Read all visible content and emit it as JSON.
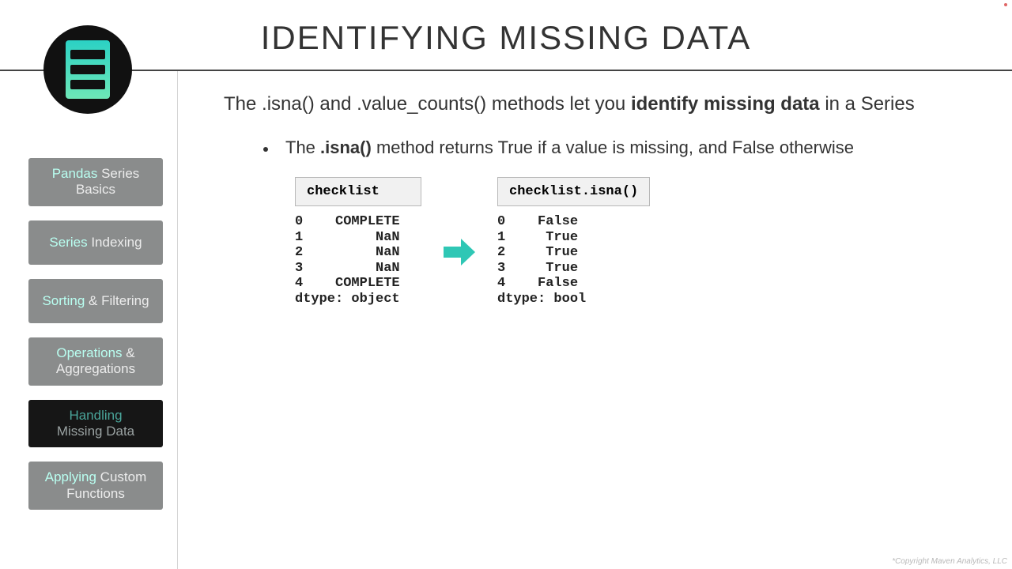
{
  "header": {
    "title": "IDENTIFYING MISSING DATA"
  },
  "sidebar": {
    "items": [
      {
        "line1_hl": "Pandas",
        "line1_rest": " Series",
        "line2": "Basics"
      },
      {
        "line1_hl": "Series",
        "line1_rest": " Indexing"
      },
      {
        "line1_hl": "Sorting",
        "line1_rest": " & Filtering"
      },
      {
        "line1_hl": "Operations",
        "line1_rest": " &",
        "line2": "Aggregations"
      },
      {
        "line1_hl": "Handling",
        "line2": "Missing Data",
        "active": true
      },
      {
        "line1_hl": "Applying",
        "line1_rest": " Custom",
        "line2": "Functions"
      }
    ]
  },
  "main": {
    "intro_pre": "The .isna() and .value_counts() methods let you ",
    "intro_bold": "identify missing data",
    "intro_post": " in a Series",
    "bullet_pre": "The ",
    "bullet_bold": ".isna()",
    "bullet_post": " method returns True if a value is missing, and False otherwise",
    "code_left_header": "checklist",
    "code_left_body": "0    COMPLETE\n1         NaN\n2         NaN\n3         NaN\n4    COMPLETE\ndtype: object",
    "code_right_header": "checklist.isna()",
    "code_right_body": "0    False\n1     True\n2     True\n3     True\n4    False\ndtype: bool"
  },
  "footer": {
    "copyright": "*Copyright Maven Analytics, LLC"
  }
}
